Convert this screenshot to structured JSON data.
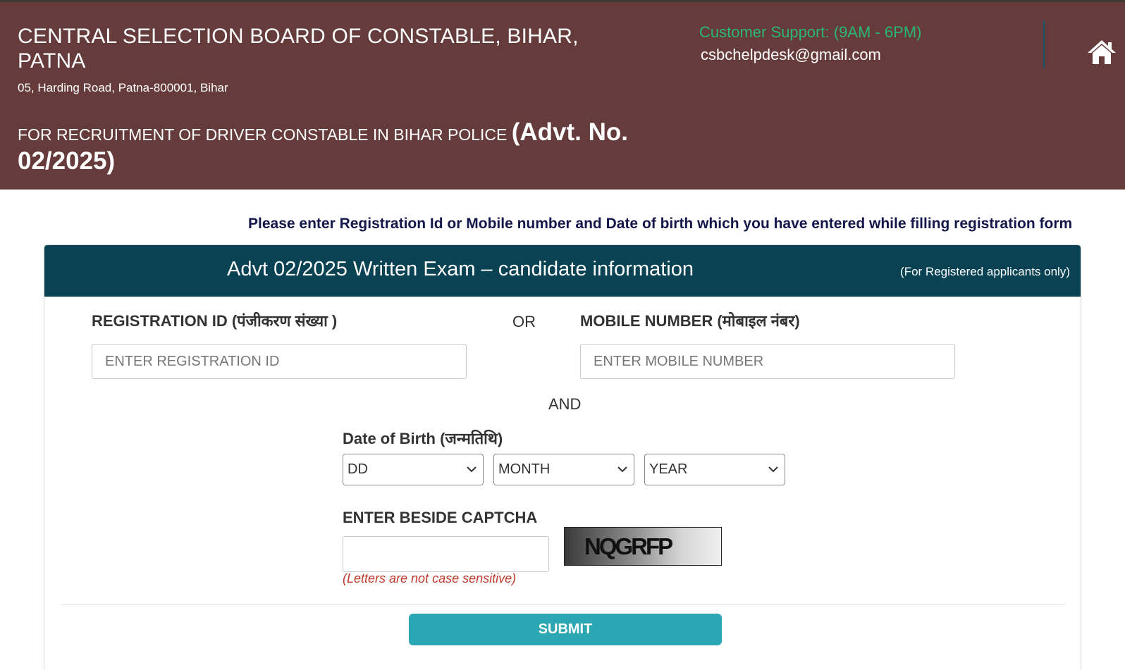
{
  "header": {
    "org_title": "CENTRAL SELECTION BOARD OF CONSTABLE, BIHAR, PATNA",
    "address": "05, Harding Road, Patna-800001, Bihar",
    "recruitment_text": "FOR RECRUITMENT OF DRIVER CONSTABLE IN BIHAR POLICE ",
    "advt_text": "(Advt. No. 02/2025)",
    "support_label": "Customer Support: (9AM - 6PM)",
    "support_email": "csbchelpdesk@gmail.com",
    "home_icon": "home-icon"
  },
  "instruction": "Please enter Registration Id or Mobile number and Date of birth which you have entered while filling registration form",
  "panel": {
    "title": "Advt 02/2025 Written Exam – candidate information",
    "note": "(For Registered applicants only)"
  },
  "form": {
    "registration_label": "REGISTRATION ID (पंजीकरण संख्या )",
    "registration_placeholder": "ENTER REGISTRATION ID",
    "or_text": "OR",
    "mobile_label": "MOBILE NUMBER (मोबाइल नंबर)",
    "mobile_placeholder": "ENTER MOBILE NUMBER",
    "and_text": "AND",
    "dob_label": "Date of Birth (जन्मतिथि)",
    "dob_day": "DD",
    "dob_month": "MONTH",
    "dob_year": "YEAR",
    "captcha_label": "ENTER BESIDE CAPTCHA",
    "captcha_value": "",
    "captcha_code": "NQGRFP",
    "case_note": "(Letters are not case sensitive)",
    "submit_label": "SUBMIT"
  },
  "colors": {
    "header_bg": "#663b3c",
    "panel_header_bg": "#084253",
    "support_green": "#2bb673",
    "submit_bg": "#2aa7b2",
    "note_red": "#c0392b"
  }
}
